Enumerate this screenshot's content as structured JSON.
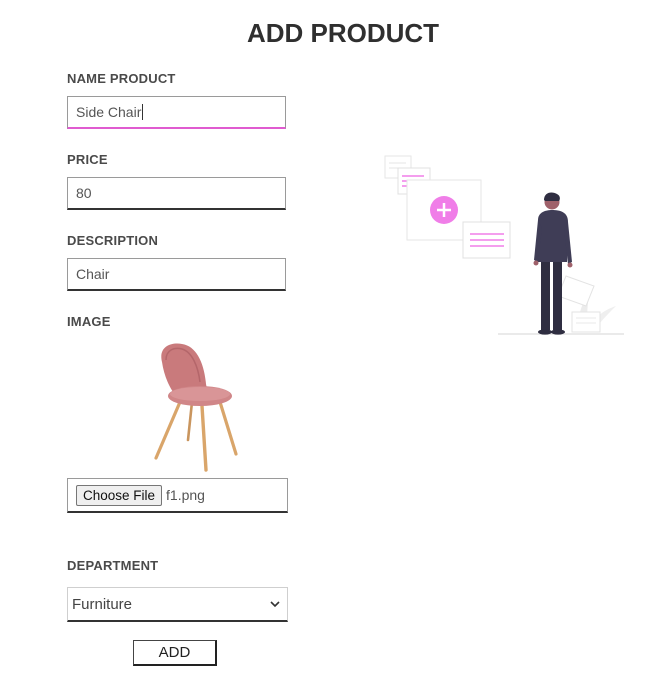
{
  "header": {
    "title": "ADD PRODUCT"
  },
  "form": {
    "name": {
      "label": "NAME PRODUCT",
      "value": "Side Chair"
    },
    "price": {
      "label": "PRICE",
      "value": "80"
    },
    "description": {
      "label": "DESCRIPTION",
      "value": "Chair"
    },
    "image": {
      "label": "IMAGE",
      "choose_label": "Choose File",
      "filename": "f1.png"
    },
    "department": {
      "label": "DEPARTMENT",
      "selected": "Furniture"
    },
    "submit_label": "ADD"
  },
  "colors": {
    "accent": "#f07ee8",
    "chair": "#c97a7c",
    "legs": "#d9a56a",
    "figure": "#2f2e41"
  }
}
